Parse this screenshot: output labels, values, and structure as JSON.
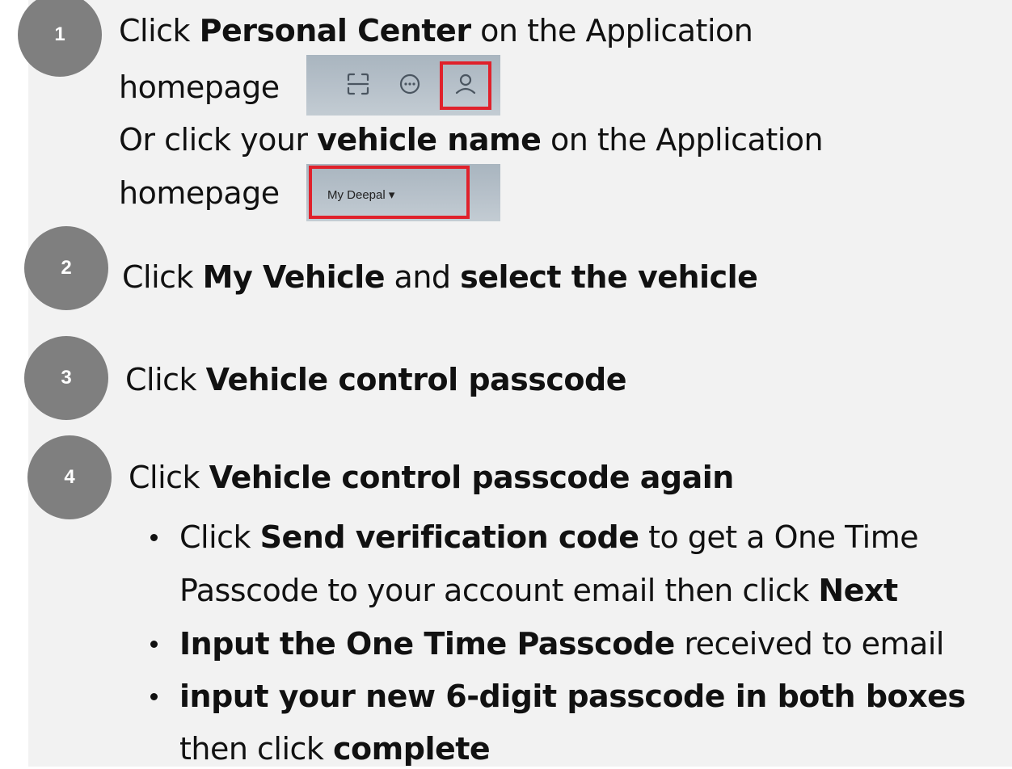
{
  "steps": [
    {
      "number": "1",
      "lines": [
        {
          "parts": [
            {
              "t": "Click ",
              "b": false
            },
            {
              "t": "Personal Center",
              "b": true
            },
            {
              "t": " on the Application",
              "b": false
            }
          ]
        },
        {
          "parts": [
            {
              "t": "homepage",
              "b": false
            }
          ]
        },
        {
          "parts": [
            {
              "t": "Or click your ",
              "b": false
            },
            {
              "t": "vehicle name",
              "b": true
            },
            {
              "t": " on the Application",
              "b": false
            }
          ]
        },
        {
          "parts": [
            {
              "t": "homepage",
              "b": false
            }
          ]
        }
      ]
    },
    {
      "number": "2",
      "lines": [
        {
          "parts": [
            {
              "t": "Click ",
              "b": false
            },
            {
              "t": "My Vehicle",
              "b": true
            },
            {
              "t": " and ",
              "b": false
            },
            {
              "t": "select the vehicle",
              "b": true
            }
          ]
        }
      ]
    },
    {
      "number": "3",
      "lines": [
        {
          "parts": [
            {
              "t": "Click ",
              "b": false
            },
            {
              "t": "Vehicle control passcode",
              "b": true
            }
          ]
        }
      ]
    },
    {
      "number": "4",
      "lines": [
        {
          "parts": [
            {
              "t": "Click ",
              "b": false
            },
            {
              "t": "Vehicle control passcode again",
              "b": true
            }
          ]
        }
      ]
    }
  ],
  "bullets": [
    {
      "parts": [
        {
          "t": "Click ",
          "b": false
        },
        {
          "t": "Send verification code",
          "b": true
        },
        {
          "t": " to get a One Time",
          "b": false
        }
      ]
    },
    {
      "parts": [
        {
          "t": "Passcode to your account email then click ",
          "b": false
        },
        {
          "t": "Next",
          "b": true
        }
      ]
    },
    {
      "parts": [
        {
          "t": "Input the One Time Passcode",
          "b": true
        },
        {
          "t": " received to email",
          "b": false
        }
      ]
    },
    {
      "parts": [
        {
          "t": "input your new 6-digit passcode in both boxes",
          "b": true
        }
      ]
    },
    {
      "parts": [
        {
          "t": "then click ",
          "b": false
        },
        {
          "t": "complete",
          "b": true
        }
      ]
    }
  ],
  "snippets": {
    "toolbar_icons": [
      "scan-icon",
      "message-icon",
      "person-icon"
    ],
    "highlight_color": "#e0212b",
    "vehicle_chip_label": "My Deepal ▾"
  },
  "colors": {
    "panel_bg": "#f2f2f2",
    "badge_bg": "#7f7f7f",
    "text": "#111111"
  }
}
